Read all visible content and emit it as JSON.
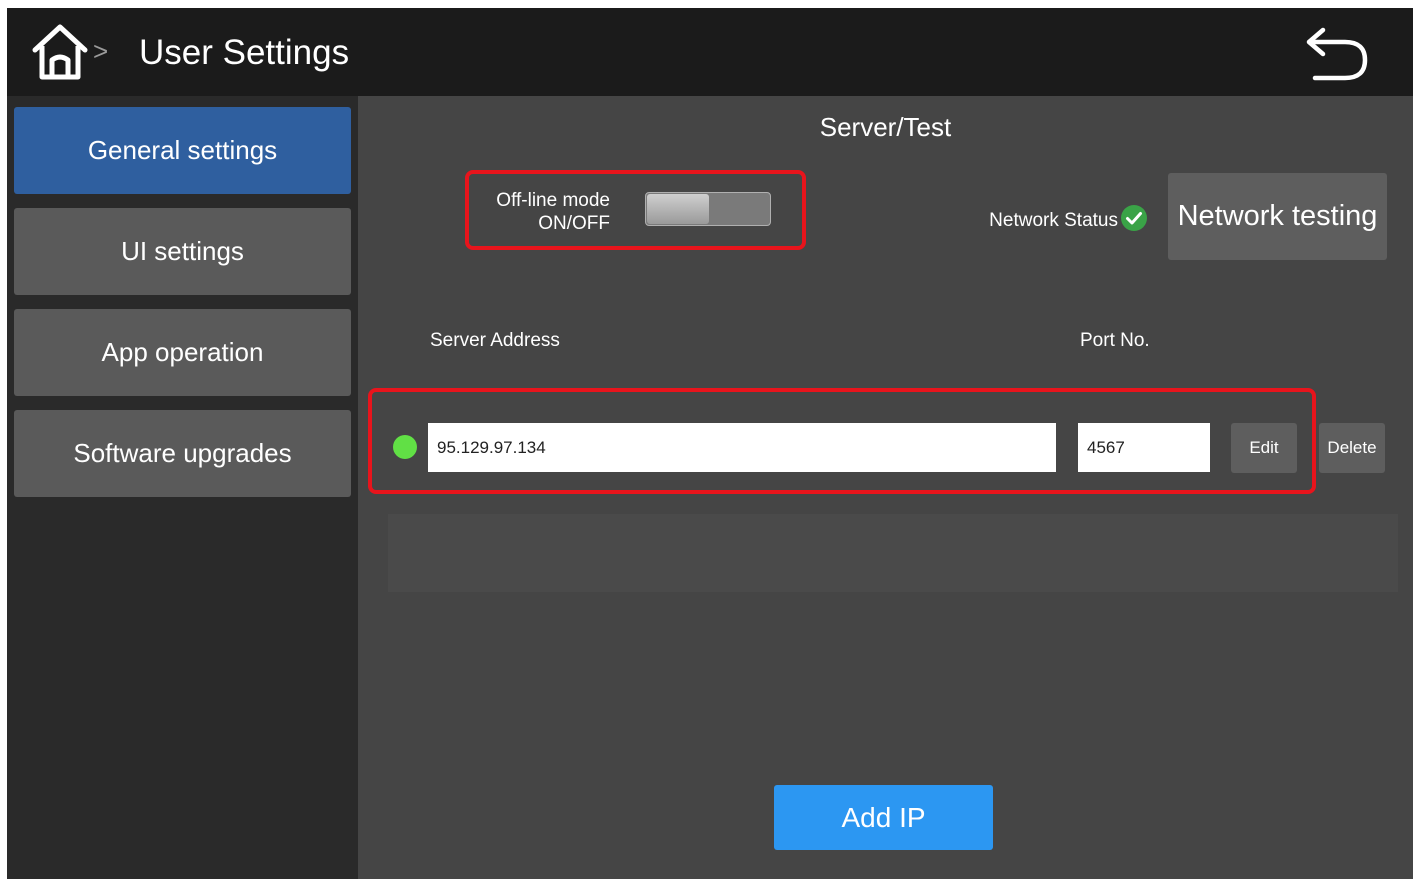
{
  "header": {
    "title": "User Settings",
    "home_icon": "home-icon",
    "chevron": ">",
    "back_icon": "undo-arrow-icon"
  },
  "sidebar": {
    "items": [
      {
        "label": "General settings",
        "active": true
      },
      {
        "label": "UI settings",
        "active": false
      },
      {
        "label": "App operation",
        "active": false
      },
      {
        "label": "Software upgrades",
        "active": false
      }
    ]
  },
  "main": {
    "section_title": "Server/Test",
    "offline_mode": {
      "label_line1": "Off-line mode",
      "label_line2": "ON/OFF",
      "state": "off"
    },
    "network_status": {
      "label": "Network Status",
      "status": "ok",
      "icon": "check-circle-icon"
    },
    "network_testing_button": "Network testing",
    "columns": {
      "server_address": "Server Address",
      "port": "Port No."
    },
    "servers": [
      {
        "address": "95.129.97.134",
        "port": "4567",
        "connected": true,
        "edit_label": "Edit",
        "delete_label": "Delete"
      }
    ],
    "add_ip_button": "Add IP"
  },
  "colors": {
    "header_bg": "#1b1b1b",
    "sidebar_bg": "#2a2a2a",
    "main_bg": "#454545",
    "active_item": "#2f5f9f",
    "button_gray": "#5e5e5e",
    "primary_blue": "#2c97f2",
    "highlight_red": "#e8141c",
    "status_green": "#61e045"
  }
}
